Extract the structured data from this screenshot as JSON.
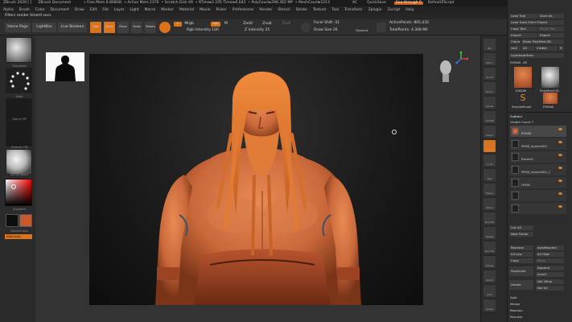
{
  "title": {
    "app": "ZBrush 2020 [ ]",
    "document": "ZBrush Document",
    "free_mem": "• Free Mem 8.808GB",
    "active_mem": "• Active Mem 2376",
    "scratch": "• Scratch Disk 49",
    "rtime": "• RTime▸2.105 Timer▸0.043",
    "polycount": "• PolyCount▸298.362 MP",
    "meshcount": "• MeshCount▸1213",
    "ac": "AC",
    "quicksave": "QuickSave",
    "see_through": "See-through 0",
    "default_script": "DefaultZScript"
  },
  "menu": [
    "Alpha",
    "Brush",
    "Color",
    "Document",
    "Draw",
    "Edit",
    "File",
    "Layer",
    "Light",
    "Macro",
    "Marker",
    "Material",
    "Movie",
    "Picker",
    "Preferences",
    "Render",
    "Stencil",
    "Stroke",
    "Texture",
    "Tool",
    "Transform",
    "Zplugin",
    "Zscript",
    "Help"
  ],
  "info_bar": "Filters render timer0 secs",
  "toolbar": {
    "home_page": "Home Page",
    "lightbox": "LightBox",
    "live_boolean": "Live Boolean",
    "edit": "Edit",
    "draw": "Draw",
    "move": "Move",
    "scale": "Scale",
    "rotate": "Rotate",
    "a_label": "A",
    "mrgb": "Mrgb",
    "rgb": "Rgb",
    "m": "M",
    "zadd": "Zadd",
    "zsub": "Zsub",
    "zcut": "Zcut",
    "rgb_intensity": "Rgb Intensity 100",
    "z_intensity": "Z Intensity 25",
    "focal_shift": "Focal Shift -31",
    "draw_size": "Draw Size 26",
    "dynamic": "Dynamic",
    "active_points": "ActivePoints: 805,435",
    "total_points": "TotalPoints: 4.308 Mil"
  },
  "left_shelf": {
    "standard": "Standard",
    "dots": "Dots",
    "alpha_off": "Alpha Off",
    "texture_off": "Texture Off",
    "material": "SkinShade4",
    "gradient": "Gradient",
    "switch_color": "SwitchColor",
    "alternate": "Alternate"
  },
  "right_shelf": [
    "Bpr",
    "SPix 3",
    "Scroll",
    "Zoom",
    "Actual",
    "AAHalf",
    "Persp",
    "Floor",
    "Local",
    "Xyz",
    "Frame",
    "Move",
    "ZoomD",
    "Rotate",
    "Line Fill",
    "Transp",
    "Ghost",
    "Solo",
    "Xpose"
  ],
  "right_panel": {
    "load_tool": "Load Tool",
    "save_as": "Save As",
    "load_tools_from_project": "Load Tools From Project",
    "copy_tool": "Copy Tool",
    "paste_tool": "Paste Tool",
    "import": "Import",
    "export": "Export",
    "clone": "Clone",
    "make_polymesh3d": "Make PolyMesh3D",
    "goz": "GoZ",
    "all": "All",
    "visible": "Visible",
    "r": "R",
    "lightbox_tools": "Lightbox▸Tools",
    "eh_dw_fullname": "EHDWI. 48",
    "tool1": "EHDWI",
    "tool2": "PolyMesh3D",
    "tool3": "SimpleBrush",
    "tool4": "EHDWI",
    "subtool": "Subtool",
    "visible_count": "Visible Count 7",
    "subtools": [
      "EHDWI",
      "PM3D_Sphere3D1",
      "Extract1",
      "PM3D_Sphere3D1_1",
      "HOOK",
      "",
      ""
    ],
    "list_all": "List All",
    "new_folder": "New Folder",
    "rename": "Rename",
    "autoreorder": "AutoReorder",
    "all_low": "All Low",
    "all_high": "All High",
    "copy": "Copy",
    "paste": "Paste",
    "duplicate": "Duplicate",
    "append": "Append",
    "insert": "Insert",
    "delete": "Delete",
    "del_other": "Del Other",
    "del_all": "Del All",
    "split": "Split",
    "merge": "Merge",
    "boolean": "Boolean",
    "remesh": "Remesh"
  },
  "colors": {
    "accent": "#d9731c",
    "primary_color": "#1a1a1a",
    "secondary_color": "#c65a2e",
    "model_clay": "#d2703a"
  }
}
